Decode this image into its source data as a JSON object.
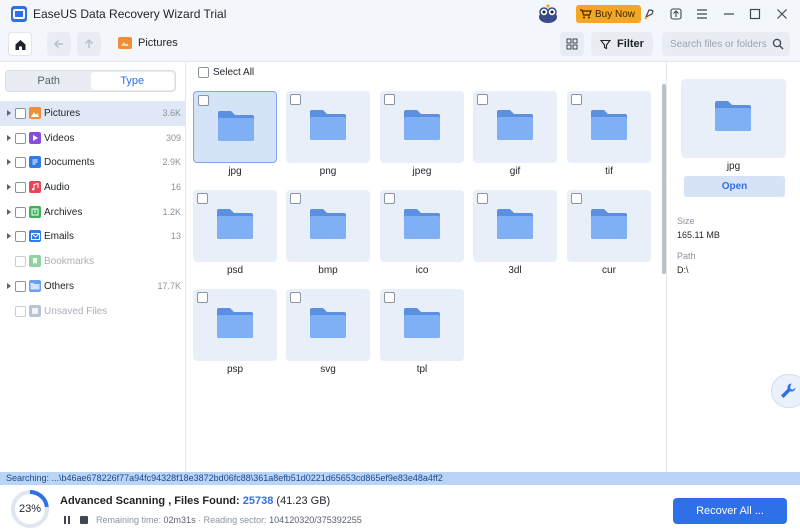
{
  "app": {
    "title": "EaseUS Data Recovery Wizard Trial",
    "buy_label": "Buy Now"
  },
  "titlebar_icons": [
    "rocket-icon",
    "upload-icon",
    "menu-icon",
    "minimize-icon",
    "maximize-icon",
    "close-icon"
  ],
  "breadcrumb": {
    "label": "Pictures"
  },
  "toolbar": {
    "filter_label": "Filter",
    "search_placeholder": "Search files or folders"
  },
  "sidebar": {
    "tabs": [
      {
        "label": "Path",
        "active": false
      },
      {
        "label": "Type",
        "active": true
      }
    ],
    "items": [
      {
        "label": "Pictures",
        "count": "3.6K",
        "icon": "picture-icon",
        "color": "#f08c3a",
        "selected": true,
        "disabled": false,
        "expandable": true
      },
      {
        "label": "Videos",
        "count": "309",
        "icon": "video-icon",
        "color": "#8a4dd9",
        "selected": false,
        "disabled": false,
        "expandable": true
      },
      {
        "label": "Documents",
        "count": "2.9K",
        "icon": "document-icon",
        "color": "#2f7ce8",
        "selected": false,
        "disabled": false,
        "expandable": true
      },
      {
        "label": "Audio",
        "count": "16",
        "icon": "audio-icon",
        "color": "#e8445a",
        "selected": false,
        "disabled": false,
        "expandable": true
      },
      {
        "label": "Archives",
        "count": "1.2K",
        "icon": "archive-icon",
        "color": "#3fb35a",
        "selected": false,
        "disabled": false,
        "expandable": true
      },
      {
        "label": "Emails",
        "count": "13",
        "icon": "email-icon",
        "color": "#2f7ce8",
        "selected": false,
        "disabled": false,
        "expandable": true
      },
      {
        "label": "Bookmarks",
        "count": "",
        "icon": "bookmark-icon",
        "color": "#8fd3a0",
        "selected": false,
        "disabled": true,
        "expandable": false
      },
      {
        "label": "Others",
        "count": "17.7K",
        "icon": "folder-icon",
        "color": "#6aa0f0",
        "selected": false,
        "disabled": false,
        "expandable": true
      },
      {
        "label": "Unsaved Files",
        "count": "",
        "icon": "unsaved-file-icon",
        "color": "#b8c4d6",
        "selected": false,
        "disabled": true,
        "expandable": false
      }
    ]
  },
  "main": {
    "select_all_label": "Select All",
    "folders": [
      {
        "label": "jpg",
        "selected": true
      },
      {
        "label": "png",
        "selected": false
      },
      {
        "label": "jpeg",
        "selected": false
      },
      {
        "label": "gif",
        "selected": false
      },
      {
        "label": "tif",
        "selected": false
      },
      {
        "label": "psd",
        "selected": false
      },
      {
        "label": "bmp",
        "selected": false
      },
      {
        "label": "ico",
        "selected": false
      },
      {
        "label": "3dl",
        "selected": false
      },
      {
        "label": "cur",
        "selected": false
      },
      {
        "label": "psp",
        "selected": false
      },
      {
        "label": "svg",
        "selected": false
      },
      {
        "label": "tpl",
        "selected": false
      }
    ]
  },
  "details": {
    "name": "jpg",
    "open_label": "Open",
    "size_label": "Size",
    "size_value": "165.11 MB",
    "path_label": "Path",
    "path_value": "D:\\"
  },
  "status": {
    "searching": "Searching: ...\\b46ae678226f77a94fc94328f18e3872bd06fc88\\361a8efb51d0221d65653cd865ef9e83e48a4ff2"
  },
  "scan": {
    "progress_percent": 23,
    "progress_label": "23%",
    "title": "Advanced Scanning , Files Found: ",
    "files_found": "25738",
    "total_size": " (41.23 GB)",
    "remaining_label": "Remaining time:",
    "remaining_value": "02m31s",
    "separator": "·",
    "sector_label": "Reading sector:",
    "sector_value": "104120320/375392255"
  },
  "recover_label": "Recover All ...",
  "colors": {
    "accent": "#2f6fe8",
    "folder": "#6aa0f0",
    "tile_bg": "#e9eff9",
    "status_bg": "#b9d4f6",
    "buy": "#f5a623"
  }
}
